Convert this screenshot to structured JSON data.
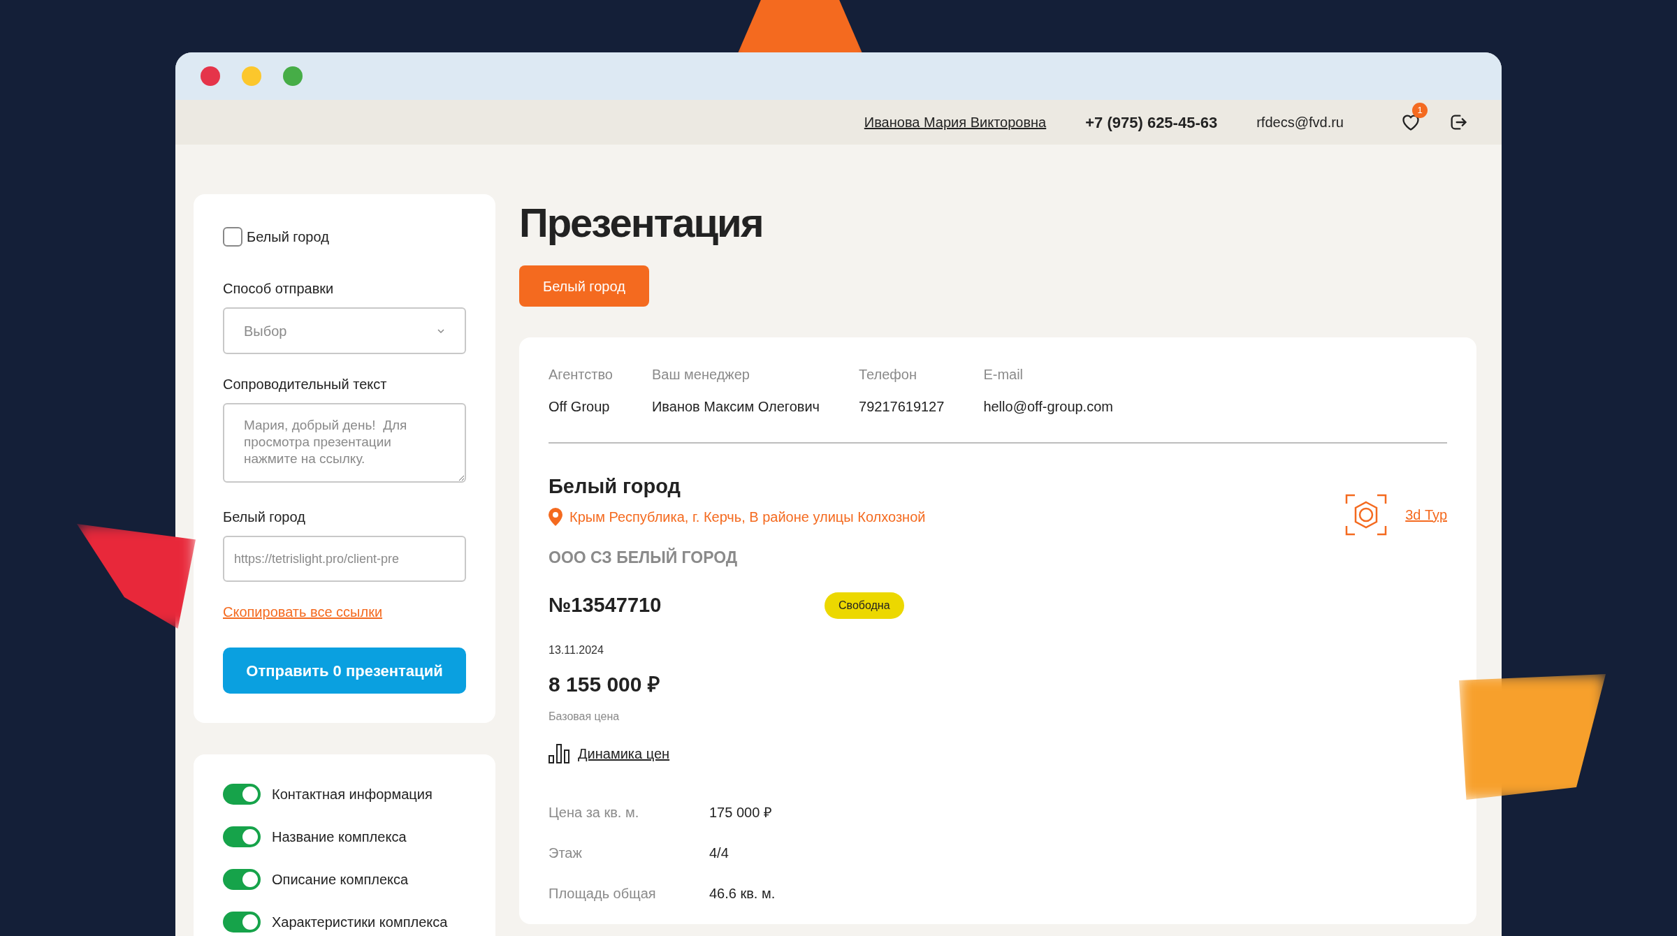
{
  "header": {
    "user_name": "Иванова Мария Викторовна",
    "phone": "+7 (975) 625-45-63",
    "email": "rfdecs@fvd.ru",
    "favorites_count": "1"
  },
  "sidebar": {
    "project_checkbox": {
      "label": "Белый город",
      "checked": false
    },
    "send_method": {
      "label": "Способ отправки",
      "placeholder": "Выбор"
    },
    "cover_text": {
      "label": "Сопроводительный текст",
      "placeholder": "Мария, добрый день!  Для просмотра презентации нажмите на ссылку."
    },
    "link_field": {
      "label": "Белый город",
      "placeholder": "https://tetrislight.pro/client-pre"
    },
    "copy_link": "Скопировать все ссылки",
    "send_button": "Отправить 0 презентаций",
    "toggles": [
      {
        "label": "Контактная информация",
        "on": true
      },
      {
        "label": "Название комплекса",
        "on": true
      },
      {
        "label": "Описание комплекса",
        "on": true
      },
      {
        "label": "Характеристики комплекса",
        "on": true
      }
    ]
  },
  "main": {
    "title": "Презентация",
    "tag_button": "Белый город",
    "contacts": [
      {
        "label": "Агентство",
        "value": "Off Group"
      },
      {
        "label": "Ваш менеджер",
        "value": "Иванов Максим Олегович"
      },
      {
        "label": "Телефон",
        "value": "79217619127"
      },
      {
        "label": "E-mail",
        "value": "hello@off-group.com"
      }
    ],
    "complex": {
      "name": "Белый город",
      "address": "Крым Республика, г. Керчь, В районе улицы Колхозной",
      "developer": "ООО СЗ БЕЛЫЙ ГОРОД",
      "tour_link": "3d Тур"
    },
    "apartment": {
      "number": "№13547710",
      "status": "Свободна",
      "date": "13.11.2024",
      "price": "8 155 000 ₽",
      "price_label": "Базовая цена",
      "dynamics_link": "Динамика цен",
      "params": [
        {
          "label": "Цена за кв. м.",
          "value": "175 000 ₽"
        },
        {
          "label": "Этаж",
          "value": "4/4"
        },
        {
          "label": "Площадь общая",
          "value": "46.6 кв. м."
        }
      ]
    }
  }
}
